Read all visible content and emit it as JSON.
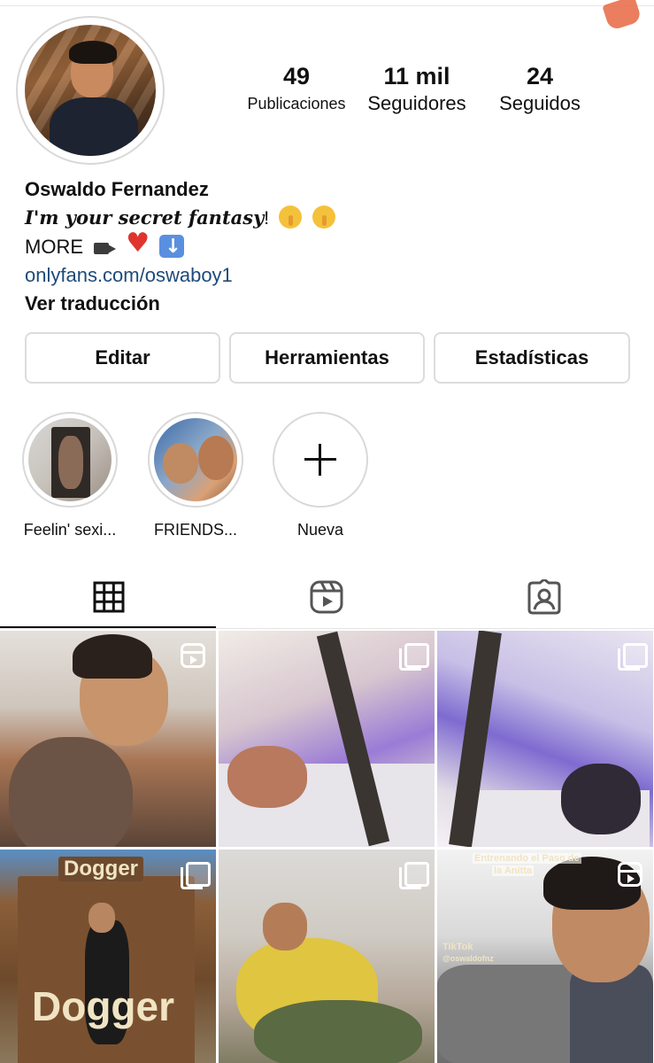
{
  "profile": {
    "stats": [
      {
        "value": "49",
        "label": "Publicaciones"
      },
      {
        "value": "11 mil",
        "label": "Seguidores"
      },
      {
        "value": "24",
        "label": "Seguidos"
      }
    ],
    "name": "Oswaldo Fernandez",
    "tagline": "I'm your secret fantasy",
    "tagline_suffix": "!",
    "more_text": "MORE",
    "link": "onlyfans.com/oswaboy1",
    "translate": "Ver traducción"
  },
  "actions": {
    "edit": "Editar",
    "tools": "Herramientas",
    "stats": "Estadísticas"
  },
  "highlights": [
    {
      "label": "Feelin' sexi..."
    },
    {
      "label": "FRIENDS..."
    },
    {
      "label": "Nueva"
    }
  ],
  "tabs": [
    {
      "icon": "grid-icon",
      "active": true
    },
    {
      "icon": "reels-icon",
      "active": false
    },
    {
      "icon": "tagged-icon",
      "active": false
    }
  ],
  "posts": [
    {
      "type": "reel",
      "text": []
    },
    {
      "type": "carousel",
      "text": []
    },
    {
      "type": "carousel",
      "text": []
    },
    {
      "type": "carousel",
      "text": [
        "Dogger",
        "Dogger"
      ]
    },
    {
      "type": "carousel",
      "text": []
    },
    {
      "type": "reel",
      "text": [
        "la Anitta",
        "TikTok",
        "@oswaldofnz"
      ]
    }
  ],
  "post_texts": {
    "sign_top": "Dogger",
    "sign_mid": "Dogger",
    "tiktok_line1": "Entrenando el Paso de",
    "tiktok_line2": "la Anitta",
    "tiktok_logo": "TikTok",
    "tiktok_user": "@oswaldofnz"
  },
  "colors": {
    "link": "#1f4a7a",
    "border": "#dcdcdc",
    "text": "#111111"
  }
}
